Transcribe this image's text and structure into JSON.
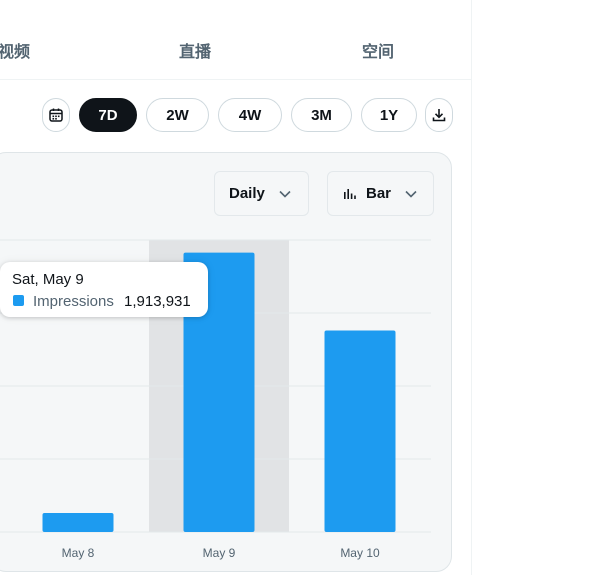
{
  "tabs": [
    "视频",
    "直播",
    "空间"
  ],
  "ranges": {
    "items": [
      "7D",
      "2W",
      "4W",
      "3M",
      "1Y"
    ],
    "active": "7D",
    "calendar_icon": "calendar-icon",
    "download_icon": "download-icon"
  },
  "controls": {
    "granularity": "Daily",
    "chart_type": "Bar",
    "chart_type_icon": "bar-chart-icon",
    "chevron_icon": "chevron-down-icon"
  },
  "tooltip": {
    "date": "Sat, May 9",
    "series": "Impressions",
    "value": "1,913,931"
  },
  "chart_data": {
    "type": "bar",
    "categories": [
      "May 8",
      "May 9",
      "May 10"
    ],
    "series": [
      {
        "name": "Impressions",
        "values": [
          130000,
          1913931,
          1380000
        ]
      }
    ],
    "ylim": [
      0,
      2000000
    ],
    "grid": true,
    "highlighted": "May 9"
  },
  "colors": {
    "bar": "#1d9bf0",
    "highlight": "#e1e3e5",
    "active_button": "#0f1419",
    "grid": "#e4e8ea"
  }
}
